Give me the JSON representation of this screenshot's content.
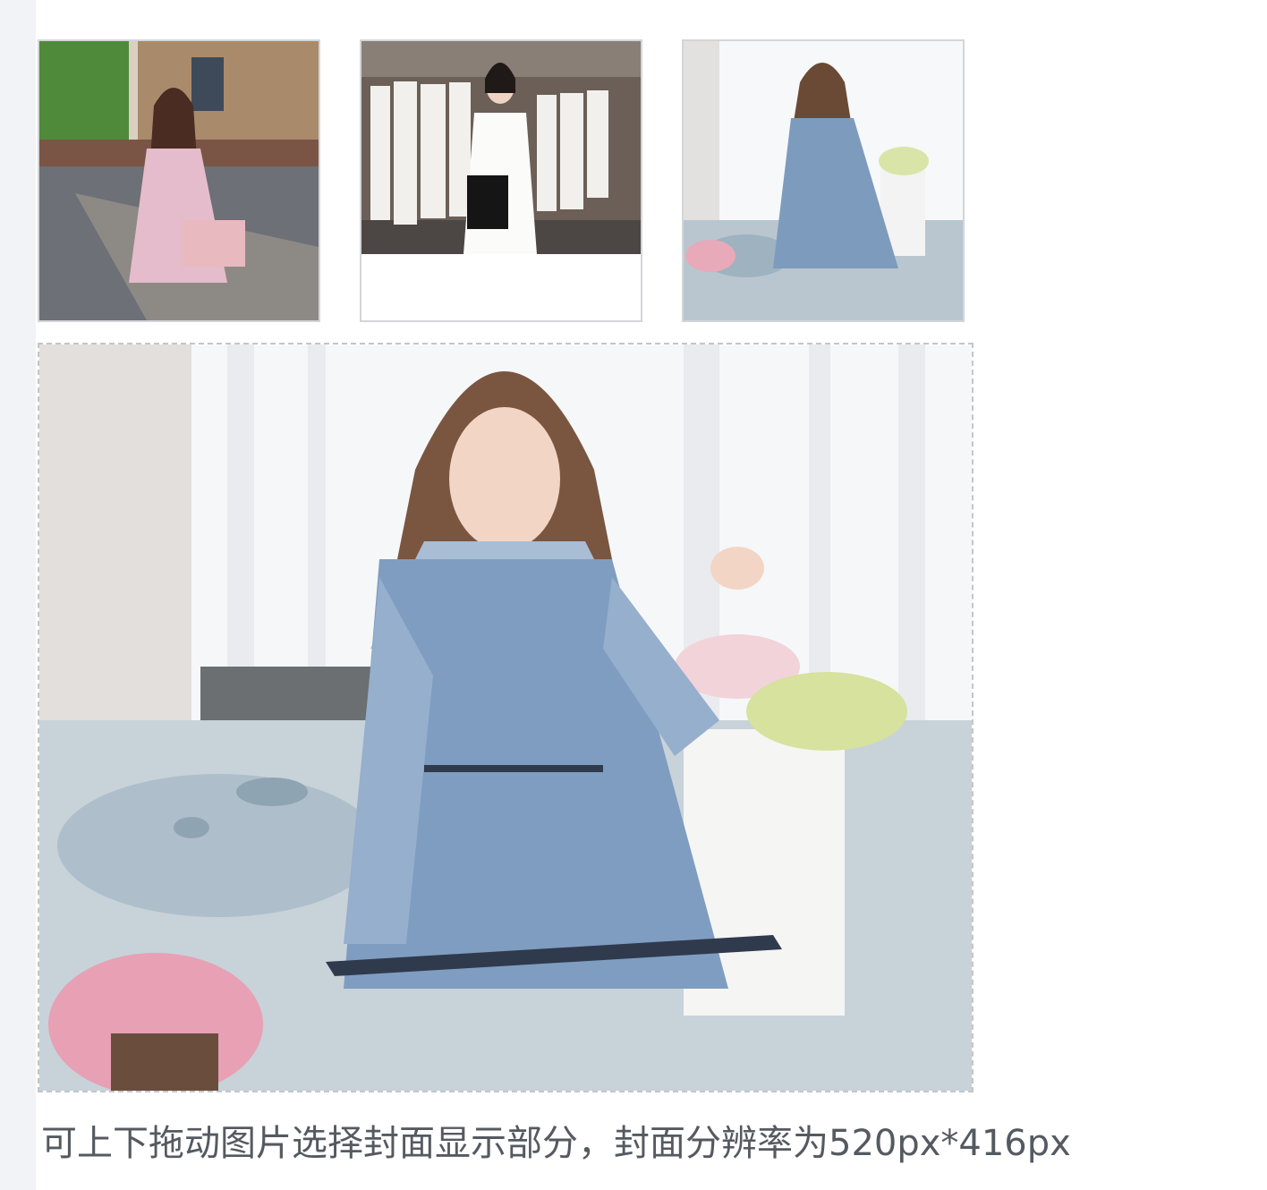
{
  "images": [
    {
      "icon": "photo-floral-dress-outdoor"
    },
    {
      "icon": "photo-white-dress-boutique"
    },
    {
      "icon": "photo-blue-dress-window"
    }
  ],
  "cover": {
    "icon": "photo-blue-dress-cover"
  },
  "hint": "可上下拖动图片选择封面显示部分，封面分辨率为520px*416px",
  "colors": {
    "thumb_border": "#d3d5d8",
    "cover_border": "#c4c6c9",
    "caption_text": "#555a61"
  }
}
